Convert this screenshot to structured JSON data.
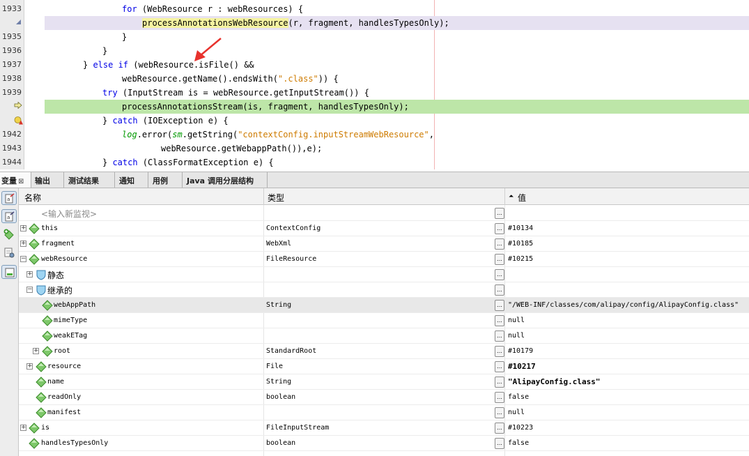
{
  "editor": {
    "lines": [
      {
        "num": "1933",
        "icon": "",
        "hl": ""
      },
      {
        "num": "",
        "icon": "collapse-marker-icon",
        "hl": "purple"
      },
      {
        "num": "1935",
        "icon": "",
        "hl": ""
      },
      {
        "num": "1936",
        "icon": "",
        "hl": ""
      },
      {
        "num": "1937",
        "icon": "",
        "hl": ""
      },
      {
        "num": "1938",
        "icon": "",
        "hl": ""
      },
      {
        "num": "1939",
        "icon": "",
        "hl": ""
      },
      {
        "num": "",
        "icon": "current-line-arrow-icon",
        "hl": "green"
      },
      {
        "num": "",
        "icon": "breakpoint-warning-icon",
        "hl": ""
      },
      {
        "num": "1942",
        "icon": "",
        "hl": ""
      },
      {
        "num": "1943",
        "icon": "",
        "hl": ""
      },
      {
        "num": "1944",
        "icon": "",
        "hl": ""
      }
    ],
    "code": {
      "l1933_a": "for",
      "l1933_b": " (WebResource r : webResources) {",
      "l1934_a": "processAnnotationsWebResource",
      "l1934_b": "(r, fragment, handlesTypesOnly);",
      "l1935": "}",
      "l1936": "}",
      "l1937_a": "} ",
      "l1937_b": "else if",
      "l1937_c": " (webResource.isFile() &&",
      "l1938_a": "webResource.getName().endsWith(",
      "l1938_b": "\".class\"",
      "l1938_c": ")) {",
      "l1939_a": "try",
      "l1939_b": " (InputStream is = webResource.getInputStream()) {",
      "l1940": "processAnnotationsStream(is, fragment, handlesTypesOnly);",
      "l1941_a": "} ",
      "l1941_b": "catch",
      "l1941_c": " (IOException e) {",
      "l1942_a": "log",
      "l1942_b": ".error(",
      "l1942_c": "sm",
      "l1942_d": ".getString(",
      "l1942_e": "\"contextConfig.inputStreamWebResource\"",
      "l1942_f": ",",
      "l1943": "webResource.getWebappPath()),e);",
      "l1944_a": "} ",
      "l1944_b": "catch",
      "l1944_c": " (ClassFormatException e) {"
    }
  },
  "tabs": [
    {
      "label": "变量",
      "close": "⊠",
      "active": true
    },
    {
      "label": "输出"
    },
    {
      "label": "测试结果"
    },
    {
      "label": "通知"
    },
    {
      "label": "用例"
    },
    {
      "label": "Java 调用分层结构"
    }
  ],
  "toolbar": {
    "icons": [
      "watch-icon",
      "variables-icon",
      "new-watch-icon",
      "settings-icon",
      "panel-icon"
    ]
  },
  "table": {
    "headers": {
      "name": "名称",
      "type": "类型",
      "value": "值",
      "sort": "⏶"
    },
    "placeholder": "<输入新监视>",
    "rows": [
      {
        "name": "this",
        "type": "ContextConfig",
        "value": "#10134",
        "expander": "+"
      },
      {
        "name": "fragment",
        "type": "WebXml",
        "value": "#10185",
        "expander": "+"
      },
      {
        "name": "webResource",
        "type": "FileResource",
        "value": "#10215",
        "expander": "−"
      },
      {
        "name": "静态",
        "type": "",
        "value": "",
        "expander": "+"
      },
      {
        "name": "继承的",
        "type": "",
        "value": "",
        "expander": "−"
      },
      {
        "name": "webAppPath",
        "type": "String",
        "value": "\"/WEB-INF/classes/com/alipay/config/AlipayConfig.class\"",
        "expander": ""
      },
      {
        "name": "mimeType",
        "type": "",
        "value": "null",
        "expander": ""
      },
      {
        "name": "weakETag",
        "type": "",
        "value": "null",
        "expander": ""
      },
      {
        "name": "root",
        "type": "StandardRoot",
        "value": "#10179",
        "expander": "+"
      },
      {
        "name": "resource",
        "type": "File",
        "value": "#10217",
        "expander": "+"
      },
      {
        "name": "name",
        "type": "String",
        "value": "\"AlipayConfig.class\"",
        "expander": ""
      },
      {
        "name": "readOnly",
        "type": "boolean",
        "value": "false",
        "expander": ""
      },
      {
        "name": "manifest",
        "type": "",
        "value": "null",
        "expander": ""
      },
      {
        "name": "is",
        "type": "FileInputStream",
        "value": "#10223",
        "expander": "+"
      },
      {
        "name": "handlesTypesOnly",
        "type": "boolean",
        "value": "false",
        "expander": ""
      }
    ],
    "edit_button": "..."
  },
  "colors": {
    "purple_highlight": "#e6e1f1",
    "green_highlight": "#bde6a8",
    "keyword": "#0000e6",
    "string": "#ce7b00",
    "field_italic": "#009900",
    "arrow": "#e8322d",
    "variable_icon": "#4caf3c"
  }
}
